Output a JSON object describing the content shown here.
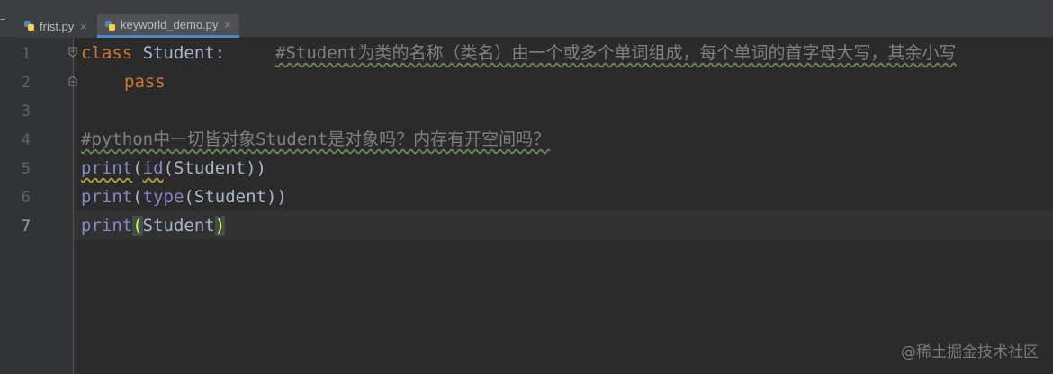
{
  "tabs": [
    {
      "label": "frist.py",
      "close": "×",
      "active": false
    },
    {
      "label": "keyworld_demo.py",
      "close": "×",
      "active": true
    }
  ],
  "tab_menu_glyph": "–",
  "line_numbers": [
    "1",
    "2",
    "3",
    "4",
    "5",
    "6",
    "7"
  ],
  "code": {
    "line1": {
      "kw": "class",
      "name": " Student:",
      "comment": "#Student为类的名称（类名）由一个或多个单词组成，每个单词的首字母大写，其余小写"
    },
    "line2": {
      "kw": "pass"
    },
    "line4": {
      "comment": "#python中一切皆对象Student是对象吗？内存有开空间吗？"
    },
    "line5": {
      "fn": "print",
      "open": "(",
      "inner_fn": "id",
      "inner_open": "(",
      "arg": "Student",
      "close": "))"
    },
    "line6": {
      "fn": "print",
      "open": "(",
      "inner_fn": "type",
      "inner_open": "(",
      "arg": "Student",
      "close": "))"
    },
    "line7": {
      "fn": "print",
      "open": "(",
      "arg": "Student",
      "close": ")"
    }
  },
  "watermark": "@稀土掘金技术社区",
  "colors": {
    "background": "#2b2b2b",
    "keyword": "#cc7832",
    "comment": "#808080",
    "builtin": "#8888c6",
    "text": "#a9b7c6"
  }
}
